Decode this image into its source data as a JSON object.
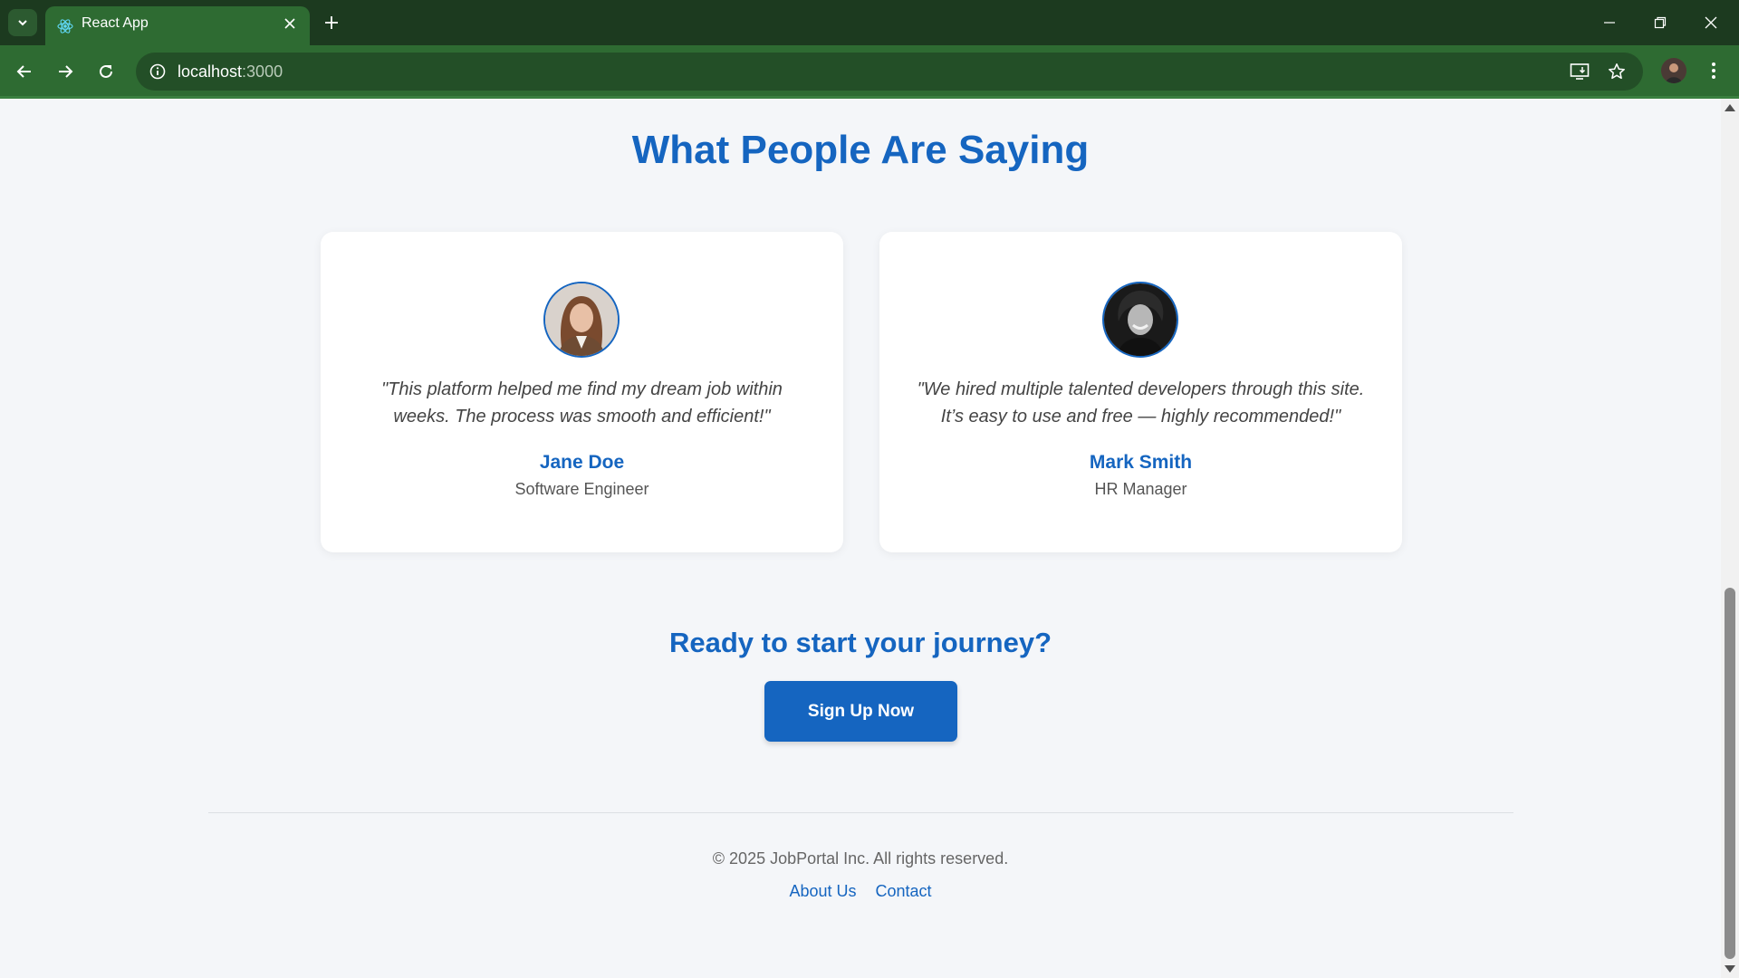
{
  "browser": {
    "tab_title": "React App",
    "url_host": "localhost",
    "url_port": ":3000",
    "icons": [
      "tab-list-icon",
      "react-favicon-icon",
      "close-icon",
      "plus-icon",
      "minimize-icon",
      "restore-icon",
      "window-close-icon",
      "back-icon",
      "forward-icon",
      "reload-icon",
      "info-icon",
      "install-icon",
      "star-icon",
      "profile-avatar",
      "more-icon"
    ]
  },
  "testimonials": {
    "heading": "What People Are Saying",
    "items": [
      {
        "quote": "\"This platform helped me find my dream job within weeks. The process was smooth and efficient!\"",
        "name": "Jane Doe",
        "role": "Software Engineer"
      },
      {
        "quote": "\"We hired multiple talented developers through this site. It’s easy to use and free — highly recommended!\"",
        "name": "Mark Smith",
        "role": "HR Manager"
      }
    ]
  },
  "cta": {
    "heading": "Ready to start your journey?",
    "button_label": "Sign Up Now"
  },
  "footer": {
    "copyright": "© 2025 JobPortal Inc. All rights reserved.",
    "links": [
      "About Us",
      "Contact"
    ]
  },
  "colors": {
    "accent": "#1565c0",
    "chrome_dark": "#1c3a1f",
    "chrome_green": "#2e6b32",
    "page_bg": "#f4f6f9"
  }
}
